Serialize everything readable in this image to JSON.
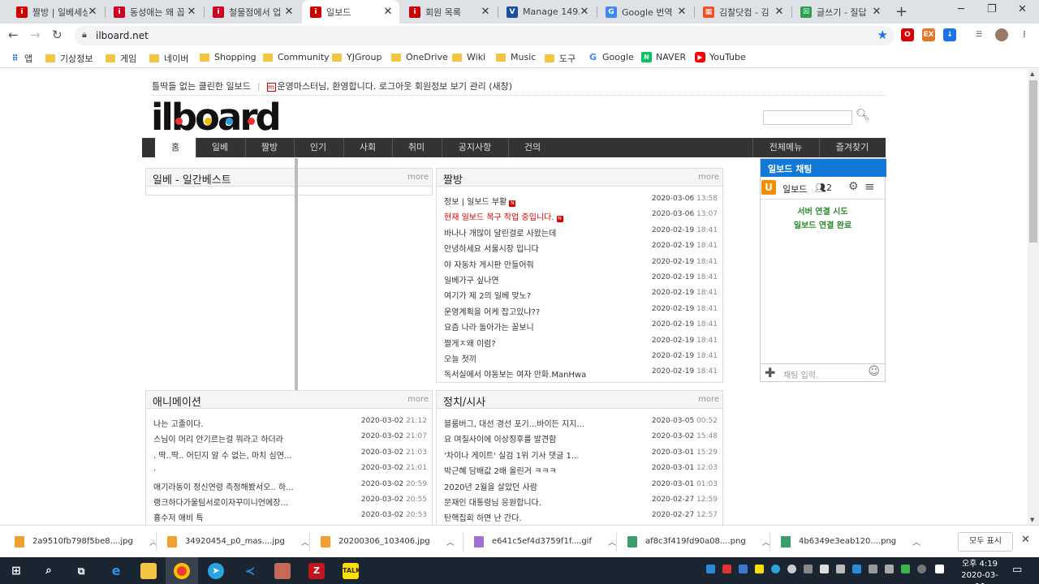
{
  "browser": {
    "tabs": [
      {
        "title": "짤방 | 일베세상",
        "fav": "#c00",
        "glyph": "i"
      },
      {
        "title": "동성애는 왜 꼽",
        "fav": "#c02",
        "glyph": "i"
      },
      {
        "title": "철물점에서 업",
        "fav": "#c02",
        "glyph": "i"
      },
      {
        "title": "일보드",
        "fav": "#c00",
        "glyph": "i",
        "active": true
      },
      {
        "title": "회원 목록",
        "fav": "#c00",
        "glyph": "i"
      },
      {
        "title": "Manage 149.2",
        "fav": "#1a4fa0",
        "glyph": "V"
      },
      {
        "title": "Google 번역",
        "fav": "#4285f4",
        "glyph": "G"
      },
      {
        "title": "김찰닷컴 - 김",
        "fav": "#f25022",
        "glyph": "▦"
      },
      {
        "title": "글쓰기 - 질답",
        "fav": "#2e9e4f",
        "glyph": "☒"
      }
    ],
    "url": "ilboard.net",
    "bookmarks": [
      "앱",
      "기상정보",
      "게임",
      "네이버",
      "Shopping",
      "Community",
      "YJGroup",
      "OneDrive",
      "Wiki",
      "Music",
      "도구",
      "Google",
      "NAVER",
      "YouTube"
    ]
  },
  "site": {
    "tagline": "틀딱들 없는 클린한 일보드",
    "welcome": "운영마스터님, 환영합니다.",
    "links": "로그아웃  회원정보 보기  관리  (새창)",
    "logo": "ilboard",
    "nav": [
      "홈",
      "일베",
      "짤방",
      "인기",
      "사회",
      "취미",
      "공지사항",
      "건의"
    ],
    "nav_right": [
      "전체메뉴",
      "즐겨찾기"
    ]
  },
  "panels": {
    "ilbe": {
      "title": "일베 - 일간베스트",
      "more": "more"
    },
    "jjal": {
      "title": "짤방",
      "more": "more",
      "rows": [
        {
          "t": "정보 | 일보드 부활",
          "d": "2020-03-06",
          "h": "13:58",
          "n": true
        },
        {
          "t": "현재 일보드 복구 작업 중입니다.",
          "d": "2020-03-06",
          "h": "13:07",
          "n": true,
          "red": true
        },
        {
          "t": "바나나 개많이 달린걸로 사왔는데",
          "d": "2020-02-19",
          "h": "18:41"
        },
        {
          "t": "안녕하세요 서울시장 입니다",
          "d": "2020-02-19",
          "h": "18:41"
        },
        {
          "t": "야 자동차 게시판 만들어줘",
          "d": "2020-02-19",
          "h": "18:41"
        },
        {
          "t": "일베가구 싶나연",
          "d": "2020-02-19",
          "h": "18:41"
        },
        {
          "t": "여기가 제 2의 일베 맞노?",
          "d": "2020-02-19",
          "h": "18:41"
        },
        {
          "t": "운영계획을 어케 잡고있냐??",
          "d": "2020-02-19",
          "h": "18:41"
        },
        {
          "t": "요즘 나라 돌아가는 꼴보니",
          "d": "2020-02-19",
          "h": "18:41"
        },
        {
          "t": "짤게ㅈ왜 이럼?",
          "d": "2020-02-19",
          "h": "18:41"
        },
        {
          "t": "오늘 첫끼",
          "d": "2020-02-19",
          "h": "18:41"
        },
        {
          "t": "독서실에서 야동보는 여자 만화.ManHwa",
          "d": "2020-02-19",
          "h": "18:41"
        }
      ]
    },
    "ani": {
      "title": "애니메이션",
      "more": "more",
      "rows": [
        {
          "t": "나는 고졸이다.",
          "d": "2020-03-02",
          "h": "21:12"
        },
        {
          "t": "스님이 머리 안기르는걸 뭐라고 하더라",
          "d": "2020-03-02",
          "h": "21:07"
        },
        {
          "t": ". 딱..딱.. 어딘지 알 수 없는, 마치 심연...",
          "d": "2020-03-02",
          "h": "21:03"
        },
        {
          "t": ".",
          "d": "2020-03-02",
          "h": "21:01"
        },
        {
          "t": "애기라동이 정신연령 측정해봤서오.. 하...",
          "d": "2020-03-02",
          "h": "20:59"
        },
        {
          "t": "랭크하다가울팀서로이자꾸미니언에장...",
          "d": "2020-03-02",
          "h": "20:55"
        },
        {
          "t": "흉수저 애비 특",
          "d": "2020-03-02",
          "h": "20:53"
        }
      ]
    },
    "politics": {
      "title": "정치/시사",
      "more": "more",
      "rows": [
        {
          "t": "블룸버그, 대선 경선 포기...바이든 지지...",
          "d": "2020-03-05",
          "h": "00:52"
        },
        {
          "t": "요 며칠사이에 이상징후를 발견함",
          "d": "2020-03-02",
          "h": "15:48"
        },
        {
          "t": "'차이나 게이트' 실검 1위 기사 댓글 1...",
          "d": "2020-03-01",
          "h": "15:29"
        },
        {
          "t": "박근혜 담배값 2배 올린거 ㅋㅋㅋ",
          "d": "2020-03-01",
          "h": "12:03"
        },
        {
          "t": "2020년 2월을 살았던 사람",
          "d": "2020-03-01",
          "h": "01:03"
        },
        {
          "t": "문재인 대통령님 응원합니다.",
          "d": "2020-02-27",
          "h": "12:59"
        },
        {
          "t": "탄핵집회 하면 난 간다.",
          "d": "2020-02-27",
          "h": "12:57"
        }
      ]
    }
  },
  "chat": {
    "title": "일보드 채팅",
    "name": "일보드",
    "count": "2",
    "messages": [
      "서버 연결 시도",
      "일보드 연결 완료"
    ],
    "placeholder": "채팅 입력."
  },
  "downloads": {
    "files": [
      "2a9510fb798f5be8....jpg",
      "34920454_p0_mas....jpg",
      "20200306_103406.jpg",
      "e641c5ef4d3759f1f....gif",
      "af8c3f419fd90a08....png",
      "4b6349e3eab120....png"
    ],
    "show_all": "모두 표시"
  },
  "taskbar": {
    "time": "오후 4:19",
    "date": "2020-03-06"
  }
}
